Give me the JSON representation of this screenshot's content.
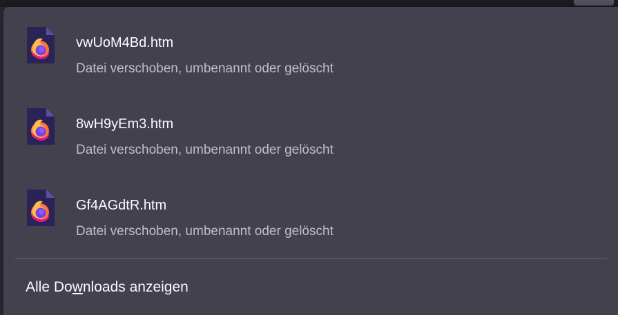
{
  "downloads_panel": {
    "items": [
      {
        "filename": "vwUoM4Bd.htm",
        "status": "Datei verschoben, umbenannt oder gelöscht",
        "icon": "firefox-html-file-icon"
      },
      {
        "filename": "8wH9yEm3.htm",
        "status": "Datei verschoben, umbenannt oder gelöscht",
        "icon": "firefox-html-file-icon"
      },
      {
        "filename": "Gf4AGdtR.htm",
        "status": "Datei verschoben, umbenannt oder gelöscht",
        "icon": "firefox-html-file-icon"
      }
    ],
    "show_all": {
      "label_before": "Alle Do",
      "label_accesskey": "w",
      "label_after": "nloads anzeigen"
    }
  },
  "colors": {
    "panel_background": "#42414d",
    "primary_text": "#fbfbfe",
    "secondary_text": "#bfbfc9",
    "separator": "#6b6a75"
  }
}
